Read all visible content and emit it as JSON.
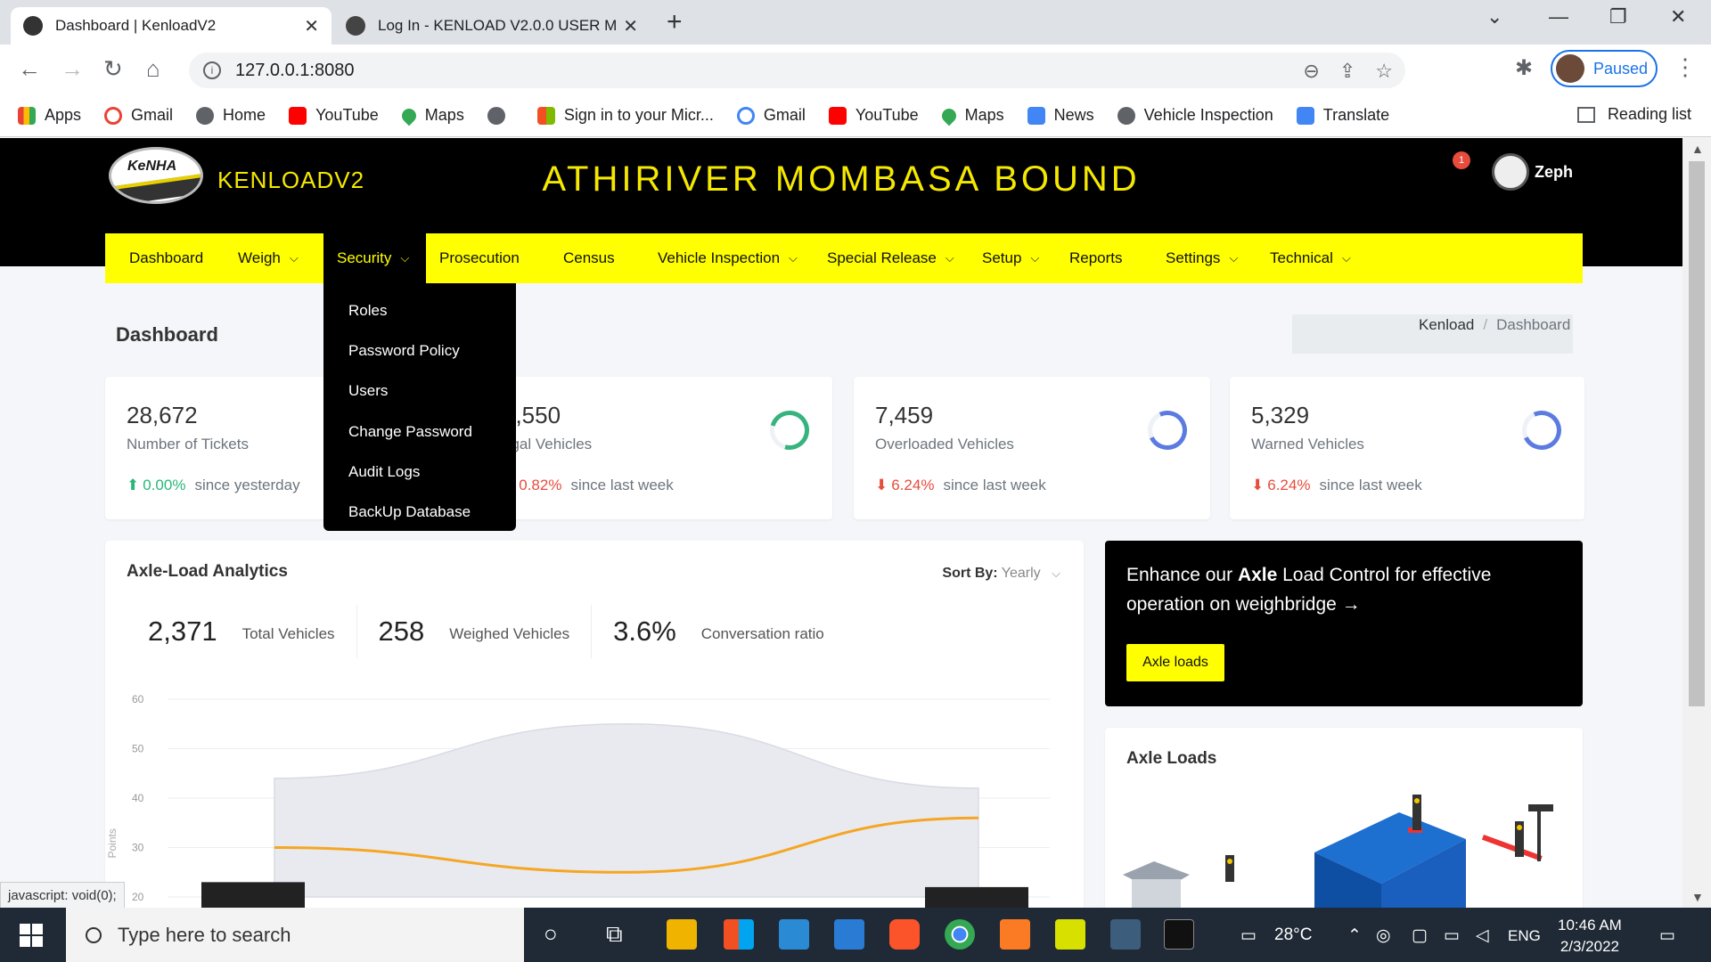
{
  "browser": {
    "tabs": [
      {
        "title": "Dashboard | KenloadV2",
        "active": true
      },
      {
        "title": "Log In - KENLOAD V2.0.0 USER M",
        "active": false
      }
    ],
    "url": "127.0.0.1:8080",
    "profile_status": "Paused",
    "bookmarks": [
      {
        "label": "Apps",
        "icon": "apps-grid-icon",
        "color": "#4285f4"
      },
      {
        "label": "Gmail",
        "icon": "google-icon",
        "color": "#ea4335"
      },
      {
        "label": "Home",
        "icon": "globe-icon",
        "color": "#5f6368"
      },
      {
        "label": "YouTube",
        "icon": "youtube-icon",
        "color": "#ff0000"
      },
      {
        "label": "Maps",
        "icon": "maps-pin-icon",
        "color": "#34a853"
      },
      {
        "label": "",
        "icon": "globe-icon",
        "color": "#5f6368"
      },
      {
        "label": "Sign in to your Micr...",
        "icon": "microsoft-icon",
        "color": "#f25022"
      },
      {
        "label": "Gmail",
        "icon": "google-icon",
        "color": "#ea4335"
      },
      {
        "label": "YouTube",
        "icon": "youtube-icon",
        "color": "#ff0000"
      },
      {
        "label": "Maps",
        "icon": "maps-pin-icon",
        "color": "#34a853"
      },
      {
        "label": "News",
        "icon": "google-news-icon",
        "color": "#4285f4"
      },
      {
        "label": "Vehicle Inspection",
        "icon": "globe-icon",
        "color": "#5f6368"
      },
      {
        "label": "Translate",
        "icon": "translate-icon",
        "color": "#4285f4"
      }
    ],
    "reading_list": "Reading list",
    "status_tip": "javascript: void(0);"
  },
  "app": {
    "logo_text": "KeNHA",
    "brand": "KENLOADV2",
    "station": "ATHIRIVER MOMBASA BOUND",
    "notification_count": "1",
    "user": "Zeph",
    "menu": [
      {
        "label": "Dashboard",
        "caret": false
      },
      {
        "label": "Weigh",
        "caret": true
      },
      {
        "label": "Security",
        "caret": true,
        "open": true
      },
      {
        "label": "Prosecution",
        "caret": false
      },
      {
        "label": "Census",
        "caret": false
      },
      {
        "label": "Vehicle Inspection",
        "caret": true
      },
      {
        "label": "Special Release",
        "caret": true
      },
      {
        "label": "Setup",
        "caret": true
      },
      {
        "label": "Reports",
        "caret": false
      },
      {
        "label": "Settings",
        "caret": true
      },
      {
        "label": "Technical",
        "caret": true
      }
    ],
    "security_dropdown": [
      "Roles",
      "Password Policy",
      "Users",
      "Change Password",
      "Audit Logs",
      "BackUp Database"
    ],
    "page_title": "Dashboard",
    "breadcrumb": {
      "root": "Kenload",
      "sep": "/",
      "current": "Dashboard"
    },
    "stats": [
      {
        "value": "28,672",
        "label": "Number of Tickets",
        "change": "0.00%",
        "direction": "up",
        "period": "since yesterday"
      },
      {
        "value": "5,550",
        "label": "egal Vehicles",
        "change": "0.82%",
        "direction": "down",
        "period": "since last week",
        "ring": "green"
      },
      {
        "value": "7,459",
        "label": "Overloaded Vehicles",
        "change": "6.24%",
        "direction": "down",
        "period": "since last week",
        "ring": "blue"
      },
      {
        "value": "5,329",
        "label": "Warned Vehicles",
        "change": "6.24%",
        "direction": "down",
        "period": "since last week",
        "ring": "blue"
      }
    ],
    "analytics": {
      "title": "Axle-Load Analytics",
      "sort_label": "Sort By:",
      "sort_value": "Yearly",
      "kpis": [
        {
          "value": "2,371",
          "label": "Total Vehicles"
        },
        {
          "value": "258",
          "label": "Weighed Vehicles"
        },
        {
          "value": "3.6%",
          "label": "Conversation ratio"
        }
      ]
    },
    "promo": {
      "text_pre": "Enhance our ",
      "text_bold": "Axle",
      "text_post": " Load Control for effective operation on weighbridge →",
      "button": "Axle loads"
    },
    "axle_loads_title": "Axle Loads"
  },
  "chart_data": {
    "type": "line",
    "ylabel": "Points",
    "yticks": [
      60,
      50,
      40,
      30,
      20
    ],
    "ylim": [
      20,
      60
    ],
    "series": [
      {
        "type": "area",
        "color": "#e9eaf0",
        "values": [
          44,
          55,
          42
        ]
      },
      {
        "type": "line",
        "color": "#f5a623",
        "values": [
          30,
          25,
          36
        ]
      },
      {
        "type": "bar",
        "color": "#222222",
        "values": [
          23,
          22
        ]
      }
    ]
  },
  "taskbar": {
    "search_placeholder": "Type here to search",
    "temperature": "28°C",
    "language": "ENG",
    "time": "10:46 AM",
    "date": "2/3/2022"
  }
}
